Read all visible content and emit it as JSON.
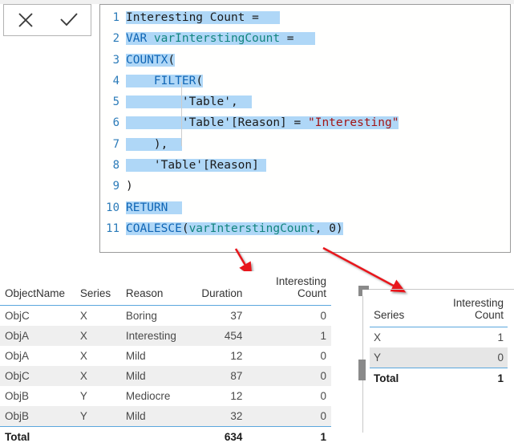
{
  "toolbar": {
    "cancel_label": "✕",
    "commit_label": "✓",
    "cancel_name": "Cancel",
    "commit_name": "Commit"
  },
  "editor": {
    "lines": [
      {
        "n": "1",
        "text": "Interesting Count ="
      },
      {
        "n": "2",
        "text": "VAR varInterstingCount ="
      },
      {
        "n": "3",
        "text": "COUNTX("
      },
      {
        "n": "4",
        "text": "    FILTER("
      },
      {
        "n": "5",
        "text": "        'Table',"
      },
      {
        "n": "6",
        "text": "        'Table'[Reason] = \"Interesting\""
      },
      {
        "n": "7",
        "text": "    ),"
      },
      {
        "n": "8",
        "text": "    'Table'[Reason]"
      },
      {
        "n": "9",
        "text": ")"
      },
      {
        "n": "10",
        "text": "RETURN"
      },
      {
        "n": "11",
        "text": "COALESCE(varInterstingCount, 0)"
      }
    ],
    "full_formula": "Interesting Count =\nVAR varInterstingCount =\nCOUNTX(\n    FILTER(\n        'Table',\n        'Table'[Reason] = \"Interesting\"\n    ),\n    'Table'[Reason]\n)\nRETURN\nCOALESCE(varInterstingCount, 0)",
    "selection_color": "#afd7f7",
    "keyword_color": "#1066b5",
    "variable_color": "#13857f",
    "string_color": "#a31515",
    "gutter_color": "#2b7bb9"
  },
  "left_table": {
    "columns": [
      "ObjectName",
      "Series",
      "Reason",
      "Duration",
      "Interesting Count"
    ],
    "rows": [
      [
        "ObjC",
        "X",
        "Boring",
        "37",
        "0"
      ],
      [
        "ObjA",
        "X",
        "Interesting",
        "454",
        "1"
      ],
      [
        "ObjA",
        "X",
        "Mild",
        "12",
        "0"
      ],
      [
        "ObjC",
        "X",
        "Mild",
        "87",
        "0"
      ],
      [
        "ObjB",
        "Y",
        "Mediocre",
        "12",
        "0"
      ],
      [
        "ObjB",
        "Y",
        "Mild",
        "32",
        "0"
      ]
    ],
    "total": [
      "Total",
      "",
      "",
      "634",
      "1"
    ]
  },
  "right_table": {
    "columns": [
      "Series",
      "Interesting Count"
    ],
    "rows": [
      [
        "X",
        "1"
      ],
      [
        "Y",
        "0"
      ]
    ],
    "total": [
      "Total",
      "1"
    ]
  },
  "annotations": {
    "arrow_color": "#e8161a",
    "arrow_1_name": "arrow-to-left-table-column",
    "arrow_2_name": "arrow-to-right-table-column"
  }
}
